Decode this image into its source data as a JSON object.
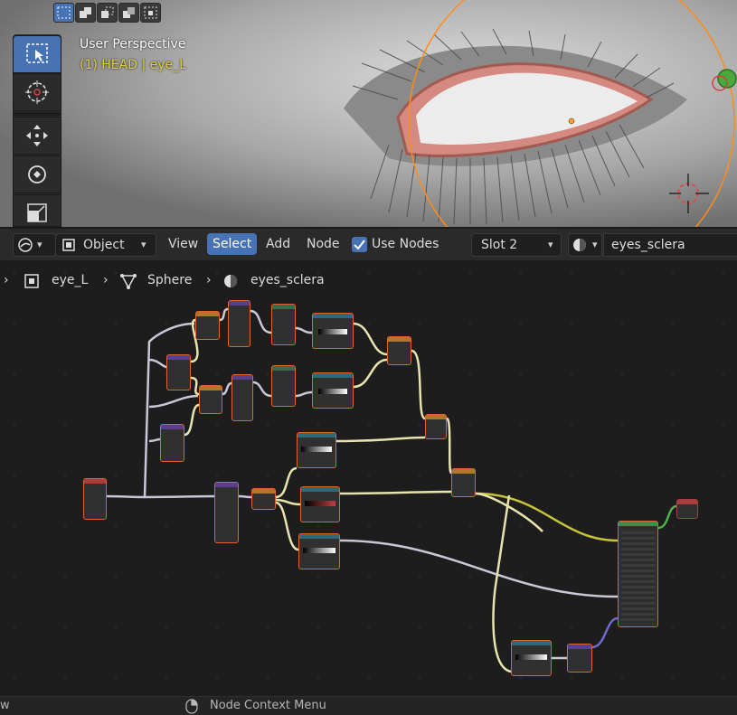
{
  "viewport": {
    "title": "User Perspective",
    "subtitle": "(1) HEAD | eye_L",
    "select_modes": [
      "select-box",
      "extend",
      "subtract",
      "invert",
      "intersect"
    ],
    "tools": [
      "select-box-icon",
      "cursor-icon",
      "move-icon",
      "rotate-icon",
      "scale-icon"
    ]
  },
  "header": {
    "editor_type_icon": "shader-editor-icon",
    "object_mode": "Object",
    "menu": [
      "View",
      "Select",
      "Add",
      "Node"
    ],
    "active_menu": "Select",
    "use_nodes_label": "Use Nodes",
    "use_nodes_checked": true,
    "slot": "Slot 2",
    "material_name": "eyes_sclera"
  },
  "breadcrumb": {
    "object": "eye_L",
    "mesh": "Sphere",
    "material": "eyes_sclera"
  },
  "statusbar": {
    "left_text": "w",
    "mouse_hint": "Node Context Menu"
  },
  "colors": {
    "accent": "#4772b3",
    "node_outline": "#e2642b",
    "wire_default": "#c8c8d8",
    "wire_yellow": "#c8c33a",
    "wire_purple": "#6b6bd0",
    "wire_green": "#4caf50",
    "wire_cream": "#e8e4b0"
  }
}
